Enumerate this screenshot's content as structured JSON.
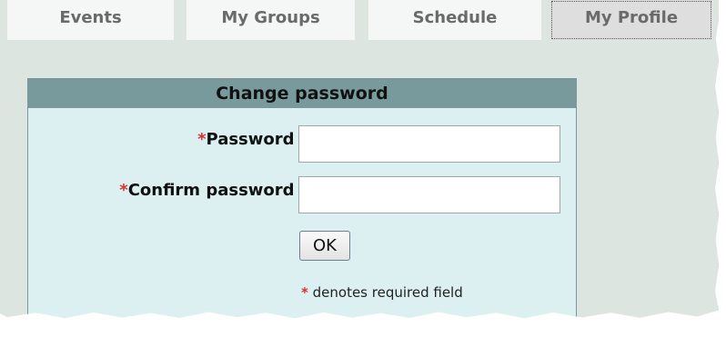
{
  "tabs": [
    {
      "label": "Events"
    },
    {
      "label": "My Groups"
    },
    {
      "label": "Schedule"
    },
    {
      "label": "My Profile",
      "active": true
    }
  ],
  "panel": {
    "title": "Change password",
    "required_marker": "*",
    "password_label": "Password :",
    "password_value": "",
    "confirm_label": "Confirm password :",
    "confirm_value": "",
    "ok_label": "OK",
    "required_note": "denotes required field"
  },
  "colors": {
    "tab_background": "#f5f7f6",
    "active_tab_background": "#dedede",
    "page_background": "#dde5e0",
    "panel_header": "#789a9d",
    "panel_body": "#dcf0f2",
    "required": "#d8322f"
  }
}
